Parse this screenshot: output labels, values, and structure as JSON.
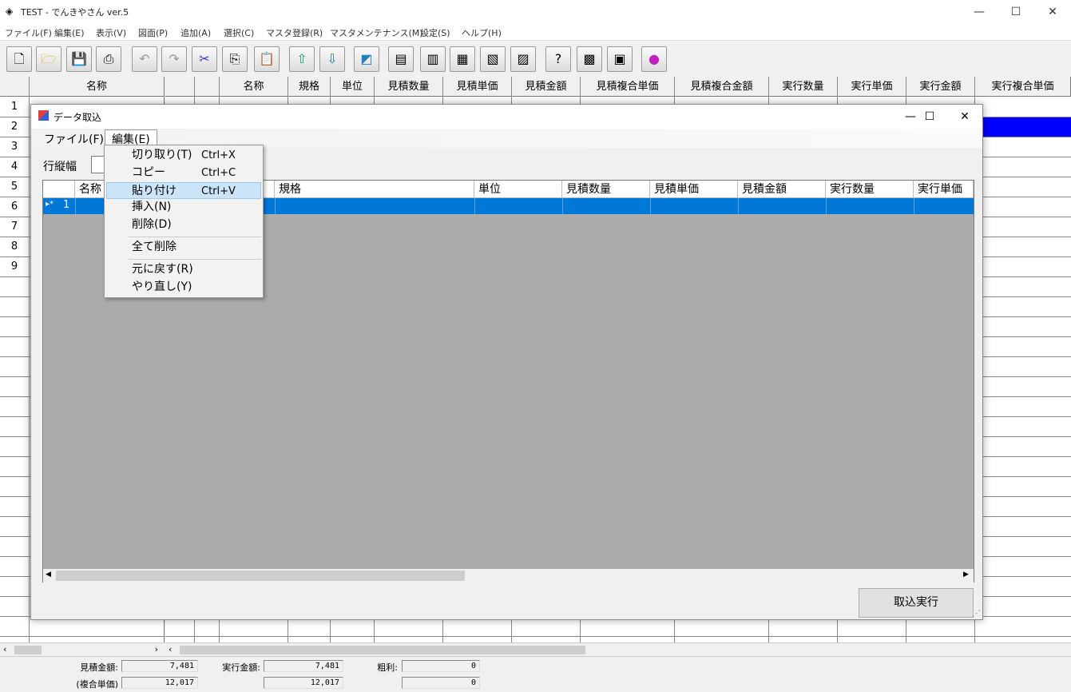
{
  "app": {
    "title": "TEST - でんきやさん ver.5",
    "menu": [
      "ファイル(F)",
      "編集(E)",
      "表示(V)",
      "図面(P)",
      "追加(A)",
      "選択(C)",
      "マスタ登録(R)",
      "マスタメンテナンス(M)",
      "設定(S)",
      "ヘルプ(H)"
    ]
  },
  "left_grid": {
    "header": "名称",
    "rows": [
      "1",
      "2",
      "3",
      "4",
      "5",
      "6",
      "7",
      "8",
      "9"
    ]
  },
  "right_grid": {
    "headers": [
      "名称",
      "規格",
      "単位",
      "見積数量",
      "見積単価",
      "見積金額",
      "見積複合単価",
      "見積複合金額",
      "実行数量",
      "実行単価",
      "実行金額",
      "実行複合単価"
    ]
  },
  "status": {
    "est_amount_label": "見積金額:",
    "est_amount": "7,481",
    "exec_amount_label": "実行金額:",
    "exec_amount": "7,481",
    "gross_label": "粗利:",
    "gross": "0",
    "composite_label": "(複合単価)",
    "est_composite": "12,017",
    "exec_composite": "12,017",
    "gross_composite": "0"
  },
  "dialog": {
    "title": "データ取込",
    "menu_file": "ファイル(F)",
    "menu_edit": "編集(E)",
    "row_height_label": "行縦幅",
    "headers": [
      "名称",
      "規格",
      "単位",
      "見積数量",
      "見積単価",
      "見積金額",
      "実行数量",
      "実行単価"
    ],
    "row_indicator": "▸*",
    "row_number": "1",
    "import_button": "取込実行"
  },
  "edit_menu": {
    "cut": "切り取り(T)",
    "cut_shortcut": "Ctrl+X",
    "copy": "コピー",
    "copy_shortcut": "Ctrl+C",
    "paste": "貼り付け",
    "paste_shortcut": "Ctrl+V",
    "insert": "挿入(N)",
    "delete": "削除(D)",
    "delete_all": "全て削除",
    "undo": "元に戻す(R)",
    "redo": "やり直し(Y)"
  },
  "colors": {
    "selection_blue": "#0078d7",
    "back_grid_highlight": "#0000ff",
    "menu_highlight": "#cce4f7"
  }
}
